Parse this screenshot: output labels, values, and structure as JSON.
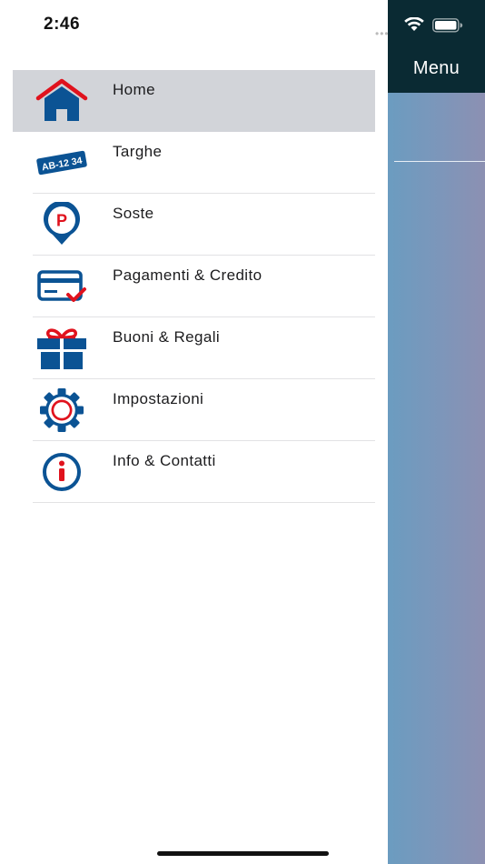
{
  "status_bar": {
    "time": "2:46"
  },
  "background_screen": {
    "header_title": "Menu"
  },
  "menu": {
    "items": [
      {
        "label": "Home",
        "icon": "home-icon",
        "active": true
      },
      {
        "label": "Targhe",
        "icon": "license-plate-icon",
        "plate_text": "AB-12 34"
      },
      {
        "label": "Soste",
        "icon": "parking-pin-icon",
        "pin_letter": "P"
      },
      {
        "label": "Pagamenti & Credito",
        "icon": "credit-card-icon"
      },
      {
        "label": "Buoni & Regali",
        "icon": "gift-icon"
      },
      {
        "label": "Impostazioni",
        "icon": "gear-icon"
      },
      {
        "label": "Info & Contatti",
        "icon": "info-icon"
      }
    ]
  },
  "colors": {
    "brand_blue": "#0b5394",
    "accent_red": "#e0121d",
    "active_row": "#d2d4d9",
    "header_dark": "#0a2a33"
  }
}
